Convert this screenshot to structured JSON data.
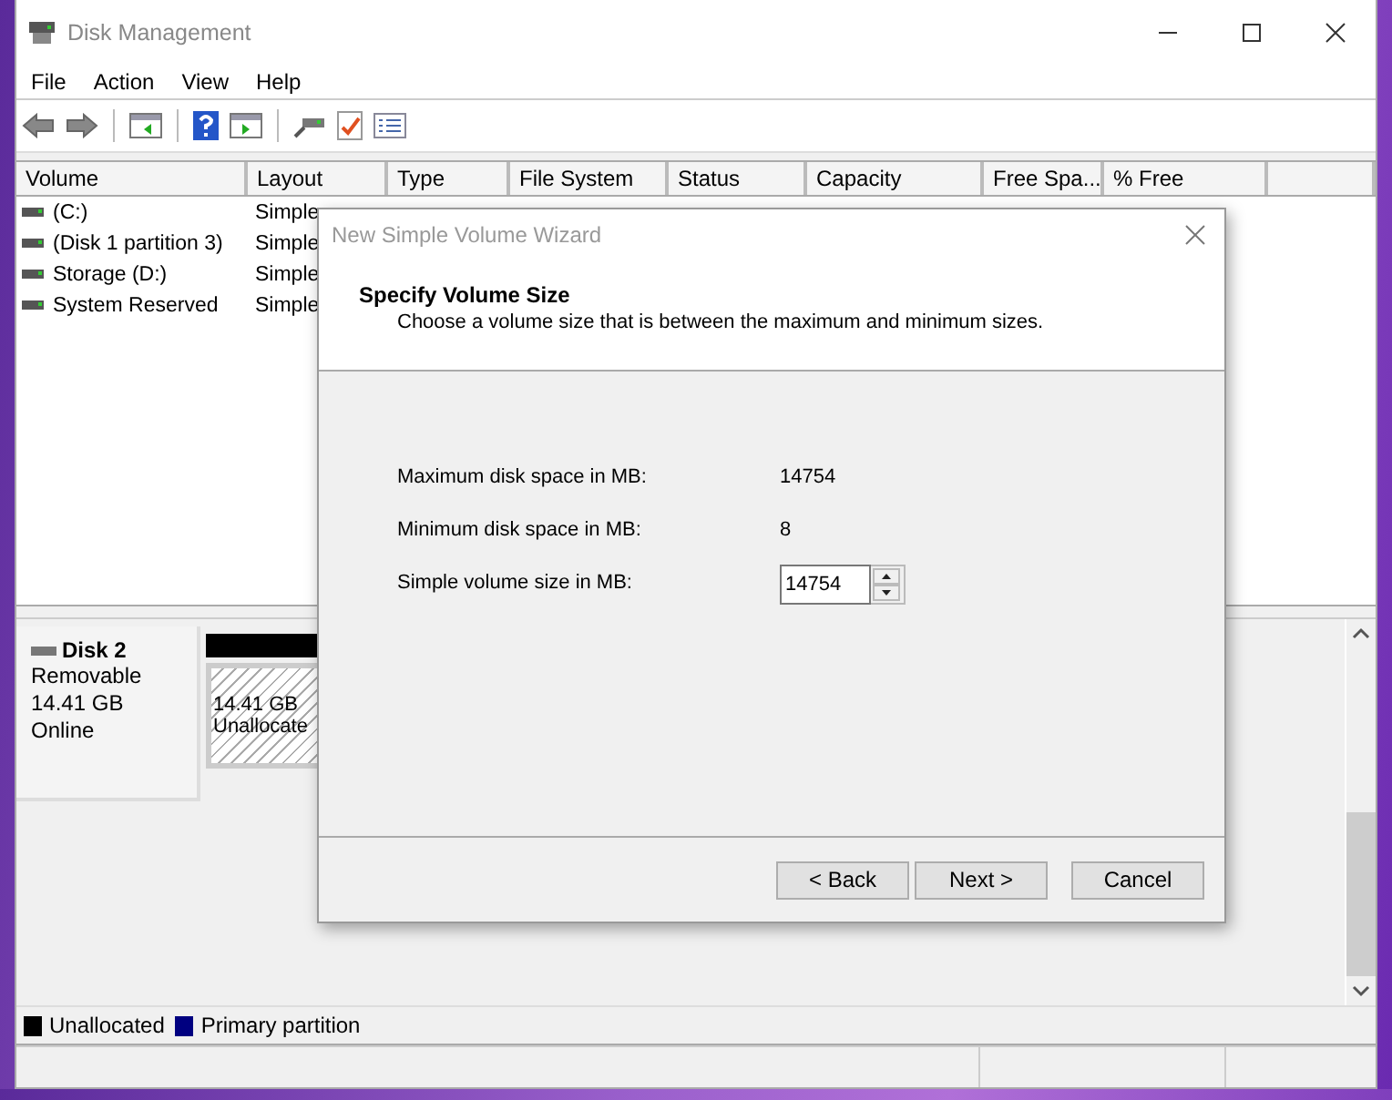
{
  "window": {
    "title": "Disk Management"
  },
  "menu": [
    "File",
    "Action",
    "View",
    "Help"
  ],
  "table": {
    "columns": [
      "Volume",
      "Layout",
      "Type",
      "File System",
      "Status",
      "Capacity",
      "Free Spa...",
      "% Free"
    ],
    "rows": [
      {
        "cells": [
          "(C:)",
          "Simple"
        ]
      },
      {
        "cells": [
          "(Disk 1 partition 3)",
          "Simple"
        ]
      },
      {
        "cells": [
          "Storage (D:)",
          "Simple"
        ]
      },
      {
        "cells": [
          "System Reserved",
          "Simple"
        ]
      }
    ]
  },
  "disks": [
    {
      "name": "Disk 2",
      "lines": [
        "Removable",
        "14.41 GB",
        "Online"
      ],
      "partitions": [
        {
          "kind": "unallocated",
          "size": "14.41 GB",
          "label": "Unallocate"
        }
      ]
    }
  ],
  "legend": [
    {
      "label": "Unallocated",
      "color": "#000000"
    },
    {
      "label": "Primary partition",
      "color": "#000080"
    }
  ],
  "dialog": {
    "title": "New Simple Volume Wizard",
    "heading": "Specify Volume Size",
    "subheading": "Choose a volume size that is between the maximum and minimum sizes.",
    "fields": [
      {
        "kind": "readout",
        "label": "Maximum disk space in MB:",
        "value": "14754"
      },
      {
        "kind": "readout",
        "label": "Minimum disk space in MB:",
        "value": "8"
      },
      {
        "kind": "spinner",
        "label": "Simple volume size in MB:",
        "value": "14754"
      }
    ],
    "buttons": [
      "< Back",
      "Next >",
      "Cancel"
    ]
  }
}
